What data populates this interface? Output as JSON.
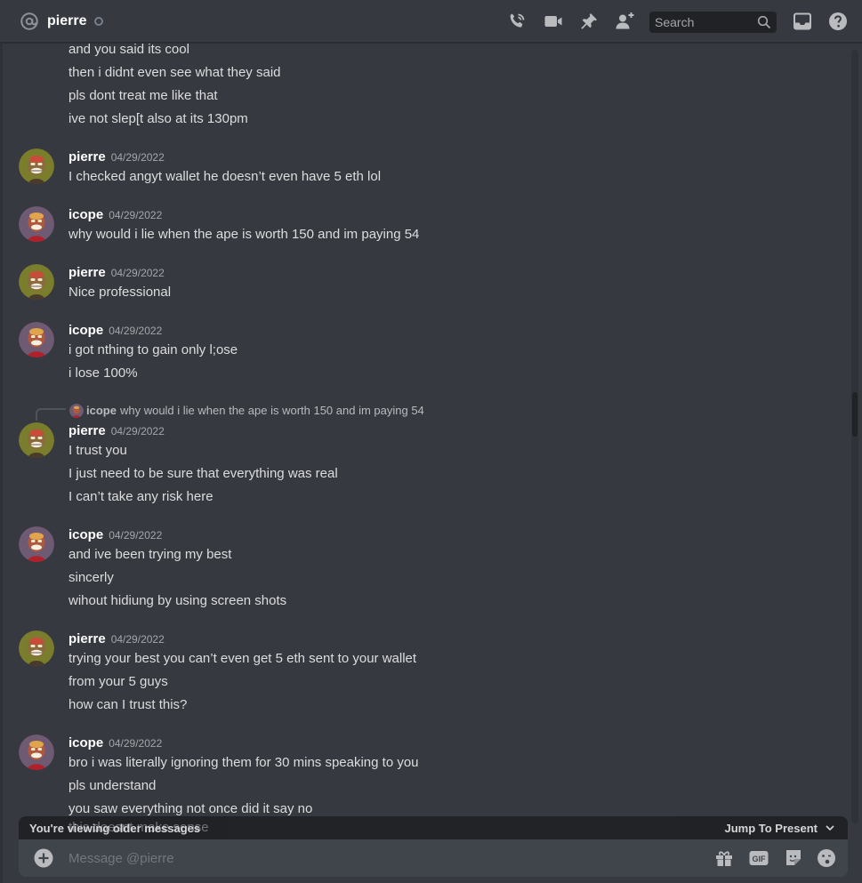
{
  "header": {
    "channel_name": "pierre",
    "search_placeholder": "Search"
  },
  "messages": [
    {
      "type": "continuation",
      "lines": [
        "and you said its cool",
        "then i didnt even see what they said",
        "pls dont treat me like that",
        "ive not slep[t also at its 130pm"
      ]
    },
    {
      "type": "group",
      "author": "pierre",
      "timestamp": "04/29/2022",
      "lines": [
        "I checked angyt wallet he doesn’t even have 5 eth lol"
      ]
    },
    {
      "type": "group",
      "author": "icope",
      "timestamp": "04/29/2022",
      "lines": [
        "why would i lie when the ape is worth 150 and im paying 54"
      ]
    },
    {
      "type": "group",
      "author": "pierre",
      "timestamp": "04/29/2022",
      "lines": [
        "Nice professional"
      ]
    },
    {
      "type": "group",
      "author": "icope",
      "timestamp": "04/29/2022",
      "lines": [
        "i got nthing to gain only l;ose",
        "i lose 100%"
      ]
    },
    {
      "type": "group",
      "author": "pierre",
      "timestamp": "04/29/2022",
      "reply": {
        "author": "icope",
        "text": "why would i lie when the ape is worth 150 and im paying 54"
      },
      "lines": [
        "I trust you",
        "I just need to be sure that everything was real",
        "I can’t take any risk here"
      ]
    },
    {
      "type": "group",
      "author": "icope",
      "timestamp": "04/29/2022",
      "lines": [
        "and ive been trying my best",
        "sincerly",
        "wihout hidiung by using screen shots"
      ]
    },
    {
      "type": "group",
      "author": "pierre",
      "timestamp": "04/29/2022",
      "lines": [
        "trying your best you can’t even get 5 eth sent to your wallet",
        "from your 5 guys",
        "how can I trust this?"
      ]
    },
    {
      "type": "group",
      "author": "icope",
      "timestamp": "04/29/2022",
      "lines": [
        "bro i was literally ignoring them for 30 mins speaking to you",
        "pls understand",
        "you saw everything not once did it say no"
      ]
    }
  ],
  "faded_line": "this doesnt make sense",
  "older_banner": {
    "text": "You're viewing older messages",
    "jump_label": "Jump To Present"
  },
  "composer": {
    "placeholder": "Message @pierre",
    "gif_label": "GIF"
  },
  "colors": {
    "background": "#36393f",
    "composer": "#40444b",
    "banner": "#202225",
    "pierre_avatar_bg": "#7a7d2c",
    "icope_avatar_bg": "#6f5a73"
  }
}
